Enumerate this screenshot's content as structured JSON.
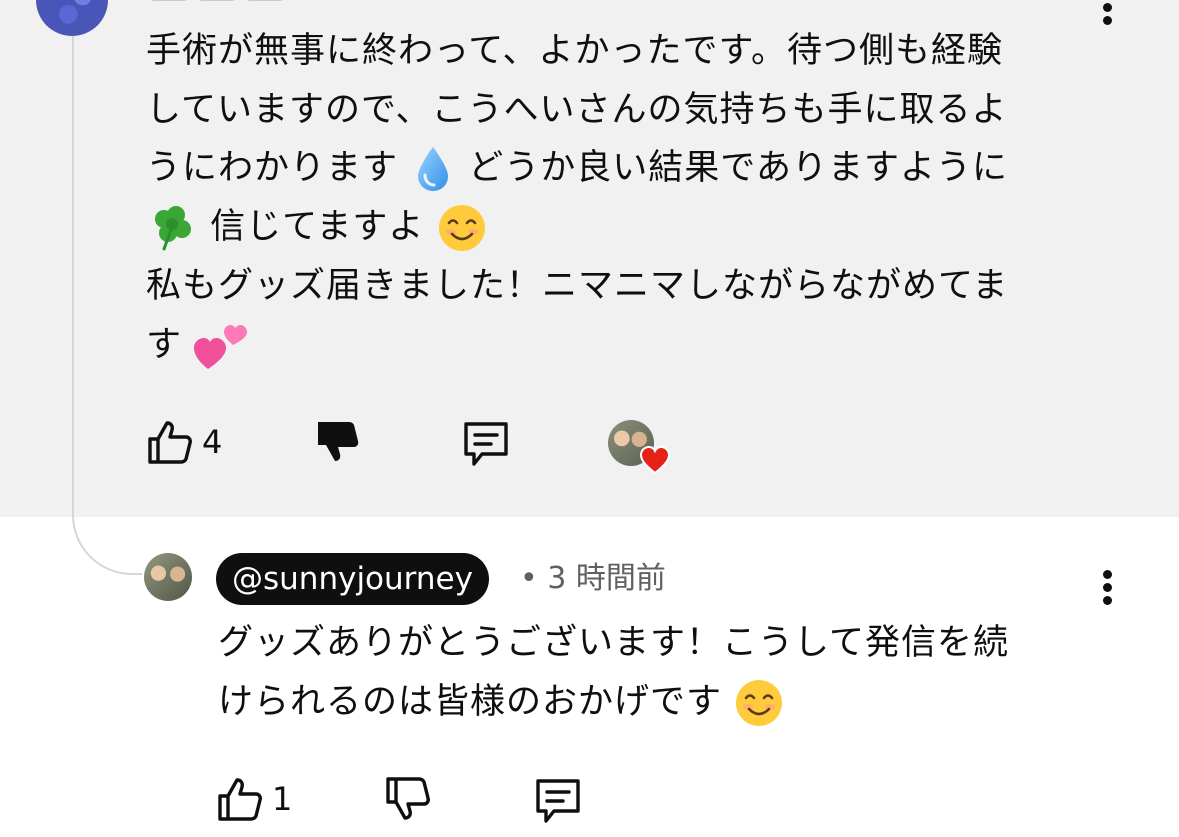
{
  "parent_comment": {
    "text_lines": [
      "手術が無事に終わって、よかったです。待つ側も経験",
      "していますので、こうへいさんの気持ちも手に取るよ",
      "うにわかります",
      "どうか良い結果でありますように",
      "信じてますよ",
      "私もグッズ届きました！ニマニマしながらながめてま",
      "す"
    ],
    "like_count": "4",
    "emojis": [
      "droplet",
      "four-leaf-clover",
      "smiling-face-with-smiling-eyes",
      "two-hearts"
    ]
  },
  "reply": {
    "handle": "@sunnyjourney",
    "separator": "•",
    "time": "3 時間前",
    "text_lines": [
      "グッズありがとうございます！こうして発信を続",
      "けられるのは皆様のおかげです"
    ],
    "like_count": "1"
  },
  "icons": {
    "like": "thumbs-up-icon",
    "dislike": "thumbs-down-icon",
    "reply": "comment-icon",
    "more": "more-vert-icon",
    "creator_heart": "heart-icon"
  },
  "colors": {
    "top_background": "#f1f1f1",
    "handle_badge": "#0f0f0f",
    "heart": "#e62117"
  }
}
